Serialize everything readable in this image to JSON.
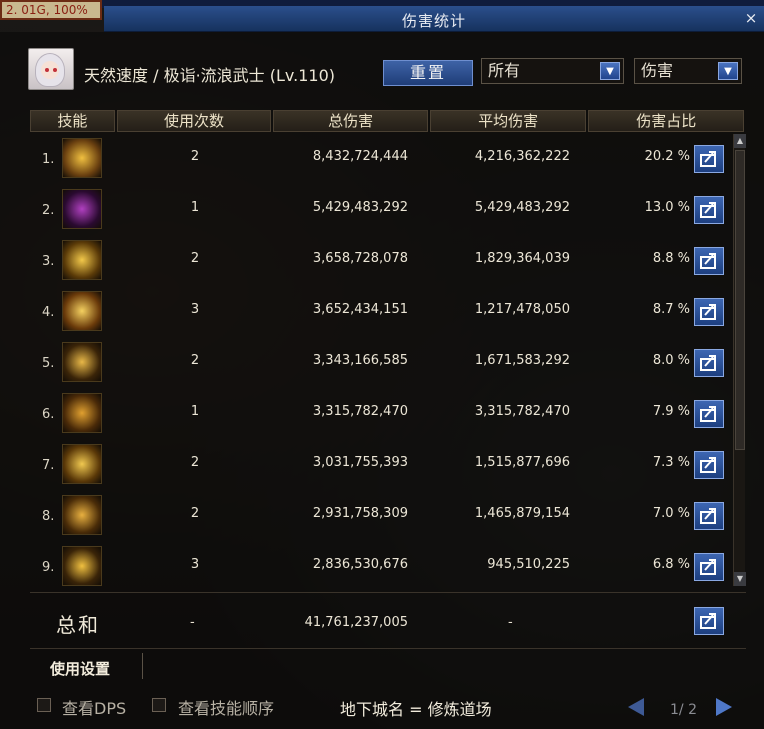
{
  "window": {
    "title": "伤害统计",
    "close_label": "×"
  },
  "memory_badge": "2. 01G, 100%",
  "character": {
    "name": "天然速度 / 极诣·流浪武士 (Lv.110)"
  },
  "controls": {
    "reset_label": "重置",
    "filter_select": "所有",
    "type_select": "伤害"
  },
  "table": {
    "headers": [
      "技能",
      "使用次数",
      "总伤害",
      "平均伤害",
      "伤害占比"
    ],
    "rows": [
      {
        "index": "1.",
        "icon": "golden-slash-skill-icon",
        "uses": "2",
        "total": "8,432,724,444",
        "average": "4,216,362,222",
        "share": "20.2 %"
      },
      {
        "index": "2.",
        "icon": "purple-warrior-skill-icon",
        "uses": "1",
        "total": "5,429,483,292",
        "average": "5,429,483,292",
        "share": "13.0 %"
      },
      {
        "index": "3.",
        "icon": "sweep-wave-skill-icon",
        "uses": "2",
        "total": "3,658,728,078",
        "average": "1,829,364,039",
        "share": "8.8 %"
      },
      {
        "index": "4.",
        "icon": "radiant-burst-skill-icon",
        "uses": "3",
        "total": "3,652,434,151",
        "average": "1,217,478,050",
        "share": "8.7 %"
      },
      {
        "index": "5.",
        "icon": "cross-slash-skill-icon",
        "uses": "2",
        "total": "3,343,166,585",
        "average": "1,671,583,292",
        "share": "8.0 %"
      },
      {
        "index": "6.",
        "icon": "vortex-skill-icon",
        "uses": "1",
        "total": "3,315,782,470",
        "average": "3,315,782,470",
        "share": "7.9 %"
      },
      {
        "index": "7.",
        "icon": "crescent-skill-icon",
        "uses": "2",
        "total": "3,031,755,393",
        "average": "1,515,877,696",
        "share": "7.3 %"
      },
      {
        "index": "8.",
        "icon": "palm-seal-skill-icon",
        "uses": "2",
        "total": "2,931,758,309",
        "average": "1,465,879,154",
        "share": "7.0 %"
      },
      {
        "index": "9.",
        "icon": "sword-sigil-skill-icon",
        "uses": "3",
        "total": "2,836,530,676",
        "average": "945,510,225",
        "share": "6.8 %"
      }
    ],
    "sum": {
      "label": "总和",
      "uses": "-",
      "total": "41,761,237,005",
      "average": "-"
    }
  },
  "settings_label": "使用设置",
  "footer": {
    "check_dps": "查看DPS",
    "check_order": "查看技能顺序",
    "dungeon": "地下城名 = 修炼道场",
    "page": "1/ 2"
  },
  "colors": {
    "accent_blue": "#2b4f8c",
    "panel": "#0e0d0c",
    "gold": "#e0b040"
  }
}
